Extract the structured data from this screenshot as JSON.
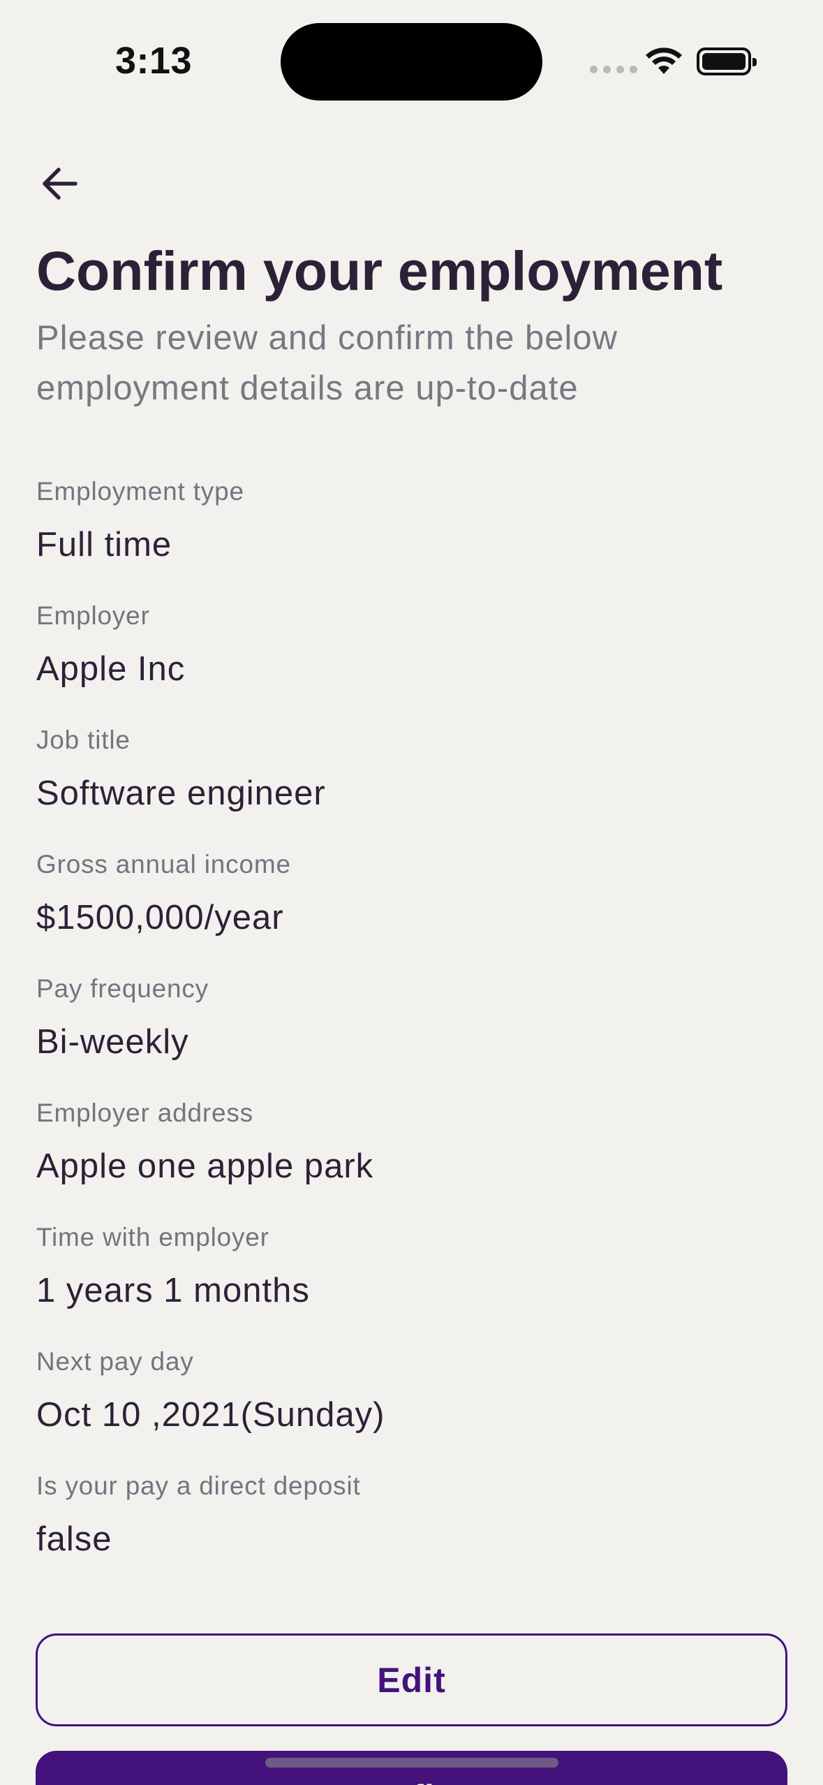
{
  "status_bar": {
    "time": "3:13"
  },
  "header": {
    "back_icon": "arrow-left-icon",
    "title": "Confirm your employment",
    "subtitle_line1": "Please review and confirm the below",
    "subtitle_line2": "employment details are up-to-date"
  },
  "details": [
    {
      "label": "Employment type",
      "value": "Full time"
    },
    {
      "label": "Employer",
      "value": "Apple Inc"
    },
    {
      "label": "Job title",
      "value": "Software engineer"
    },
    {
      "label": "Gross annual income",
      "value": "$1500,000/year"
    },
    {
      "label": "Pay frequency",
      "value": "Bi-weekly"
    },
    {
      "label": "Employer address",
      "value": "Apple one apple park"
    },
    {
      "label": "Time with employer",
      "value": "1 years 1 months"
    },
    {
      "label": "Next pay day",
      "value": "Oct 10 ,2021(Sunday)"
    },
    {
      "label": "Is your pay a direct deposit",
      "value": "false"
    }
  ],
  "actions": {
    "edit_label": "Edit",
    "confirm_label": "Confirm"
  },
  "colors": {
    "background": "#f2f1ee",
    "primary": "#43127a",
    "text": "#2b2238",
    "muted": "#77727f"
  }
}
